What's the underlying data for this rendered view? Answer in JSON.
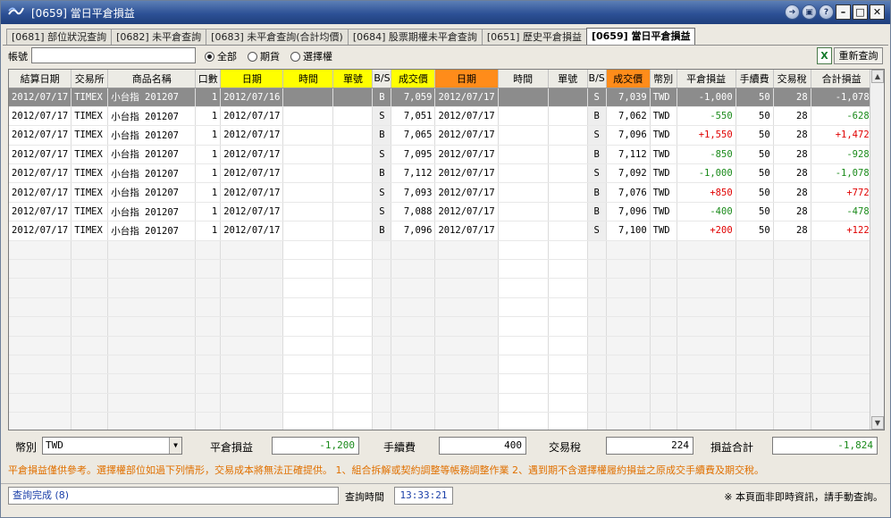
{
  "window": {
    "title": "[0659] 當日平倉損益"
  },
  "tabs": [
    {
      "label": "[0681] 部位狀況查詢"
    },
    {
      "label": "[0682] 未平倉查詢"
    },
    {
      "label": "[0683] 未平倉查詢(合計均價)"
    },
    {
      "label": "[0684] 股票期權未平倉查詢"
    },
    {
      "label": "[0651] 歷史平倉損益"
    },
    {
      "label": "[0659] 當日平倉損益"
    }
  ],
  "filter": {
    "account_label": "帳號",
    "account_value": "",
    "options": [
      {
        "label": "全部",
        "checked": true
      },
      {
        "label": "期貨",
        "checked": false
      },
      {
        "label": "選擇權",
        "checked": false
      }
    ],
    "requery_label": "重新查詢",
    "excel_label": "X"
  },
  "table": {
    "columns": [
      "結算日期",
      "交易所",
      "商品名稱",
      "口數",
      "日期",
      "時間",
      "單號",
      "B/S",
      "成交價",
      "日期",
      "時間",
      "單號",
      "B/S",
      "成交價",
      "幣別",
      "平倉損益",
      "手續費",
      "交易稅",
      "合計損益"
    ],
    "rows": [
      [
        "2012/07/17",
        "TIMEX",
        "小台指 201207",
        "1",
        "2012/07/16",
        "",
        "",
        "B",
        "7,059",
        "2012/07/17",
        "",
        "",
        "S",
        "7,039",
        "TWD",
        "-1,000",
        "50",
        "28",
        "-1,078"
      ],
      [
        "2012/07/17",
        "TIMEX",
        "小台指 201207",
        "1",
        "2012/07/17",
        "",
        "",
        "S",
        "7,051",
        "2012/07/17",
        "",
        "",
        "B",
        "7,062",
        "TWD",
        "-550",
        "50",
        "28",
        "-628"
      ],
      [
        "2012/07/17",
        "TIMEX",
        "小台指 201207",
        "1",
        "2012/07/17",
        "",
        "",
        "B",
        "7,065",
        "2012/07/17",
        "",
        "",
        "S",
        "7,096",
        "TWD",
        "+1,550",
        "50",
        "28",
        "+1,472"
      ],
      [
        "2012/07/17",
        "TIMEX",
        "小台指 201207",
        "1",
        "2012/07/17",
        "",
        "",
        "S",
        "7,095",
        "2012/07/17",
        "",
        "",
        "B",
        "7,112",
        "TWD",
        "-850",
        "50",
        "28",
        "-928"
      ],
      [
        "2012/07/17",
        "TIMEX",
        "小台指 201207",
        "1",
        "2012/07/17",
        "",
        "",
        "B",
        "7,112",
        "2012/07/17",
        "",
        "",
        "S",
        "7,092",
        "TWD",
        "-1,000",
        "50",
        "28",
        "-1,078"
      ],
      [
        "2012/07/17",
        "TIMEX",
        "小台指 201207",
        "1",
        "2012/07/17",
        "",
        "",
        "S",
        "7,093",
        "2012/07/17",
        "",
        "",
        "B",
        "7,076",
        "TWD",
        "+850",
        "50",
        "28",
        "+772"
      ],
      [
        "2012/07/17",
        "TIMEX",
        "小台指 201207",
        "1",
        "2012/07/17",
        "",
        "",
        "S",
        "7,088",
        "2012/07/17",
        "",
        "",
        "B",
        "7,096",
        "TWD",
        "-400",
        "50",
        "28",
        "-478"
      ],
      [
        "2012/07/17",
        "TIMEX",
        "小台指 201207",
        "1",
        "2012/07/17",
        "",
        "",
        "B",
        "7,096",
        "2012/07/17",
        "",
        "",
        "S",
        "7,100",
        "TWD",
        "+200",
        "50",
        "28",
        "+122"
      ]
    ]
  },
  "summary": {
    "currency_label": "幣別",
    "currency_value": "TWD",
    "close_pnl_label": "平倉損益",
    "close_pnl_value": "-1,200",
    "fee_label": "手續費",
    "fee_value": "400",
    "tax_label": "交易稅",
    "tax_value": "224",
    "total_label": "損益合計",
    "total_value": "-1,824"
  },
  "notice": "平倉損益僅供參考。選擇權部位如過下列情形，交易成本將無法正確提供。  1、組合拆解或契約調整等帳務調整作業  2、遇到期不含選擇權履約損益之原成交手續費及期交稅。",
  "status": {
    "message": "查詢完成 (8)",
    "time_label": "查詢時間",
    "time_value": "13:33:21",
    "note": "※ 本頁面非即時資訊，請手動查詢。"
  },
  "colors": {
    "profit": "#e00000",
    "loss": "#1a8a1a",
    "header_open": "#ffff00",
    "header_close": "#ff8c1a",
    "selected_row": "#8c8c8c",
    "titlebar": "#2d5196",
    "notice": "#e07000"
  }
}
